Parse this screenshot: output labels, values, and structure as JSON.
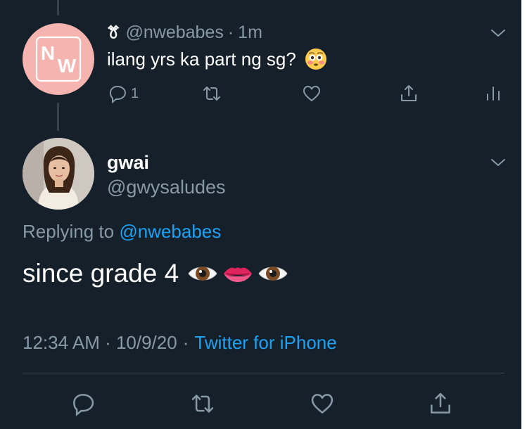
{
  "parent": {
    "display_name": "ꔢ",
    "handle": "@nwebabes",
    "separator": "·",
    "time": "1m",
    "text": "ilang yrs ka part ng sg?",
    "reply_count": "1",
    "avatar_logo": "NW",
    "icons": [
      "reply-icon",
      "retweet-icon",
      "like-icon",
      "share-icon",
      "analytics-icon",
      "chevron-down-icon",
      "flushed-face-emoji"
    ]
  },
  "tweet": {
    "display_name": "gwai",
    "handle": "@gwysaludes",
    "replying_prefix": "Replying to",
    "replying_handle": "@nwebabes",
    "text": "since grade 4",
    "emojis": [
      "eye-emoji",
      "lips-emoji",
      "eye-emoji"
    ],
    "timestamp": "12:34 AM · 10/9/20",
    "meta_separator": "·",
    "source": "Twitter for iPhone",
    "icons": [
      "reply-icon",
      "retweet-icon",
      "like-icon",
      "share-icon",
      "chevron-down-icon"
    ]
  },
  "colors": {
    "background": "#15202b",
    "secondary_text": "#8899a6",
    "link": "#1da1f2",
    "divider": "#38444d",
    "nw_avatar": "#f5b4b0"
  }
}
